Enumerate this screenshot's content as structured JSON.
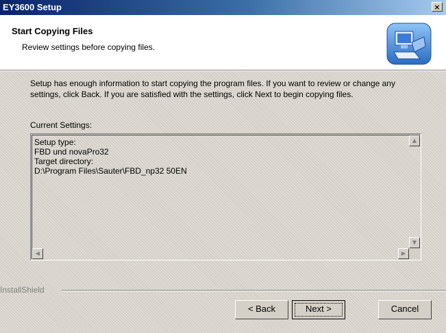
{
  "window": {
    "title": "EY3600 Setup",
    "close_glyph": "×"
  },
  "header": {
    "title": "Start Copying Files",
    "subtitle": "Review settings before copying files.",
    "icon": "setup-computer-icon"
  },
  "body": {
    "intro": "Setup has enough information to start copying the program files.  If you want to review or change any settings, click Back.  If you are satisfied with the settings, click Next to begin copying files.",
    "current_settings_label": "Current Settings:",
    "settings_lines": [
      "Setup type:",
      "FBD und novaPro32",
      "Target directory:",
      "D:\\Program Files\\Sauter\\FBD_np32 50EN"
    ]
  },
  "footer": {
    "brand": "InstallShield"
  },
  "buttons": {
    "back": "< Back",
    "next": "Next >",
    "cancel": "Cancel"
  },
  "scroll_glyphs": {
    "up": "▲",
    "down": "▼",
    "left": "◀",
    "right": "▶"
  },
  "colors": {
    "face": "#d4d0c8",
    "title_start": "#0a246a",
    "title_end": "#a6caf0"
  }
}
